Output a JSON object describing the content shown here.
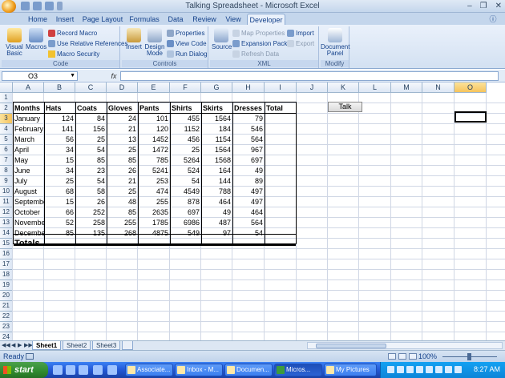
{
  "window": {
    "title": "Talking Spreadsheet - Microsoft Excel"
  },
  "ribbon_tabs": [
    "Home",
    "Insert",
    "Page Layout",
    "Formulas",
    "Data",
    "Review",
    "View",
    "Developer"
  ],
  "active_tab": "Developer",
  "ribbon": {
    "code": {
      "label": "Code",
      "visual_basic": "Visual Basic",
      "macros": "Macros",
      "record_macro": "Record Macro",
      "relative_refs": "Use Relative References",
      "macro_security": "Macro Security"
    },
    "controls": {
      "label": "Controls",
      "insert": "Insert",
      "design_mode": "Design Mode",
      "properties": "Properties",
      "view_code": "View Code",
      "run_dialog": "Run Dialog"
    },
    "xml": {
      "label": "XML",
      "source": "Source",
      "map_properties": "Map Properties",
      "expansion_packs": "Expansion Packs",
      "refresh_data": "Refresh Data",
      "import": "Import",
      "export": "Export"
    },
    "modify": {
      "label": "Modify",
      "document_panel": "Document Panel"
    }
  },
  "formula_bar": {
    "name_box": "O3",
    "fx": "fx",
    "value": ""
  },
  "columns": [
    "A",
    "B",
    "C",
    "D",
    "E",
    "F",
    "G",
    "H",
    "I",
    "J",
    "K",
    "L",
    "M",
    "N",
    "O"
  ],
  "rows": [
    "1",
    "2",
    "3",
    "4",
    "5",
    "6",
    "7",
    "8",
    "9",
    "10",
    "11",
    "12",
    "13",
    "14",
    "15",
    "16",
    "17",
    "18",
    "19",
    "20",
    "21",
    "22",
    "23",
    "24"
  ],
  "selected_cell": {
    "column": "O",
    "row": "3"
  },
  "table": {
    "headers": [
      "Months",
      "Hats",
      "Coats",
      "Gloves",
      "Pants",
      "Shirts",
      "Skirts",
      "Dresses",
      "Total"
    ],
    "data": [
      [
        "January",
        "124",
        "84",
        "24",
        "101",
        "455",
        "1564",
        "79"
      ],
      [
        "February",
        "141",
        "156",
        "21",
        "120",
        "1152",
        "184",
        "546"
      ],
      [
        "March",
        "56",
        "25",
        "13",
        "1452",
        "456",
        "1154",
        "564"
      ],
      [
        "April",
        "34",
        "54",
        "25",
        "1472",
        "25",
        "1564",
        "967"
      ],
      [
        "May",
        "15",
        "85",
        "85",
        "785",
        "5264",
        "1568",
        "697"
      ],
      [
        "June",
        "34",
        "23",
        "26",
        "5241",
        "524",
        "164",
        "49"
      ],
      [
        "July",
        "25",
        "54",
        "21",
        "253",
        "54",
        "144",
        "89"
      ],
      [
        "August",
        "68",
        "58",
        "25",
        "474",
        "4549",
        "788",
        "497"
      ],
      [
        "September",
        "15",
        "26",
        "48",
        "255",
        "878",
        "464",
        "497"
      ],
      [
        "October",
        "66",
        "252",
        "85",
        "2635",
        "697",
        "49",
        "464"
      ],
      [
        "November",
        "52",
        "258",
        "255",
        "1785",
        "6986",
        "487",
        "564"
      ],
      [
        "December",
        "85",
        "135",
        "268",
        "4875",
        "549",
        "97",
        "54"
      ]
    ],
    "totals_label": "Totals"
  },
  "talk_button": "Talk",
  "sheet_tabs": [
    "Sheet1",
    "Sheet2",
    "Sheet3"
  ],
  "active_sheet": "Sheet1",
  "status": {
    "ready": "Ready",
    "zoom": "100%"
  },
  "taskbar": {
    "start": "start",
    "tasks": [
      "Associate...",
      "Inbox - M...",
      "Documen...",
      "Micros...",
      "My Pictures"
    ],
    "active_task": "Micros...",
    "clock": "8:27 AM"
  }
}
